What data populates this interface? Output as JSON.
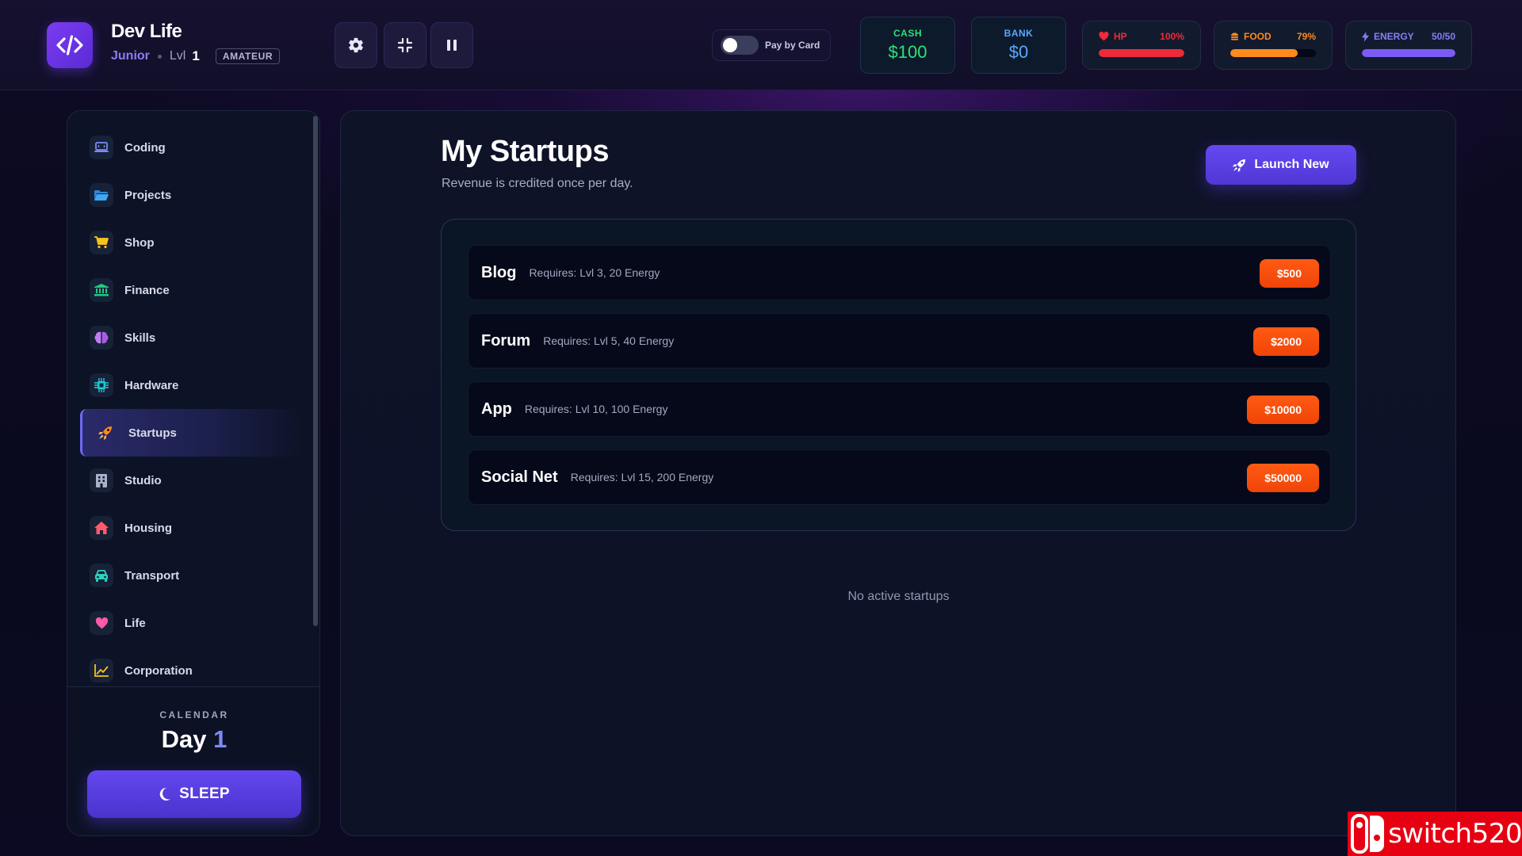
{
  "header": {
    "title": "Dev Life",
    "rank": "Junior",
    "level_label": "Lvl",
    "level_value": "1",
    "tier_badge": "AMATEUR",
    "buttons": [
      "settings",
      "collapse",
      "pause"
    ],
    "pay_toggle": {
      "label": "Pay by Card",
      "on": false
    },
    "cash": {
      "label": "CASH",
      "value": "$100",
      "color": "#2ee07a"
    },
    "bank": {
      "label": "BANK",
      "value": "$0",
      "color": "#5aa8ff"
    },
    "stats": {
      "hp": {
        "label": "HP",
        "value": "100%",
        "fraction": 1.0,
        "color": "#ef2a3a"
      },
      "food": {
        "label": "FOOD",
        "value": "79%",
        "fraction": 0.79,
        "color": "#ff8a1c"
      },
      "energy": {
        "label": "ENERGY",
        "value": "50/50",
        "fraction": 1.0,
        "color": "#7a5cf5"
      }
    }
  },
  "sidebar": {
    "items": [
      {
        "label": "Coding",
        "icon": "laptop-icon",
        "color": "#7d8af5"
      },
      {
        "label": "Projects",
        "icon": "folder-icon",
        "color": "#3fa7f5"
      },
      {
        "label": "Shop",
        "icon": "cart-icon",
        "color": "#f5c31c"
      },
      {
        "label": "Finance",
        "icon": "bank-icon",
        "color": "#22c984"
      },
      {
        "label": "Skills",
        "icon": "brain-icon",
        "color": "#c07cf5"
      },
      {
        "label": "Hardware",
        "icon": "chip-icon",
        "color": "#22c8d6"
      },
      {
        "label": "Startups",
        "icon": "rocket-icon",
        "color": "#ff8a1c",
        "active": true
      },
      {
        "label": "Studio",
        "icon": "building-icon",
        "color": "#aab0c8"
      },
      {
        "label": "Housing",
        "icon": "house-icon",
        "color": "#ff5a6a"
      },
      {
        "label": "Transport",
        "icon": "car-icon",
        "color": "#2ed3c0"
      },
      {
        "label": "Life",
        "icon": "heart-icon",
        "color": "#ff5aa8"
      },
      {
        "label": "Corporation",
        "icon": "chart-icon",
        "color": "#f5c31c"
      }
    ],
    "calendar_label": "CALENDAR",
    "day_word": "Day",
    "day_number": "1",
    "sleep_label": "SLEEP"
  },
  "main": {
    "title": "My Startups",
    "subtitle": "Revenue is credited once per day.",
    "launch_label": "Launch New",
    "startups": [
      {
        "name": "Blog",
        "requires": "Requires: Lvl 3, 20 Energy",
        "price": "$500"
      },
      {
        "name": "Forum",
        "requires": "Requires: Lvl 5, 40 Energy",
        "price": "$2000"
      },
      {
        "name": "App",
        "requires": "Requires: Lvl 10, 100 Energy",
        "price": "$10000"
      },
      {
        "name": "Social Net",
        "requires": "Requires: Lvl 15, 200 Energy",
        "price": "$50000"
      }
    ],
    "empty_text": "No active startups"
  },
  "watermark": {
    "text": "switch520"
  }
}
